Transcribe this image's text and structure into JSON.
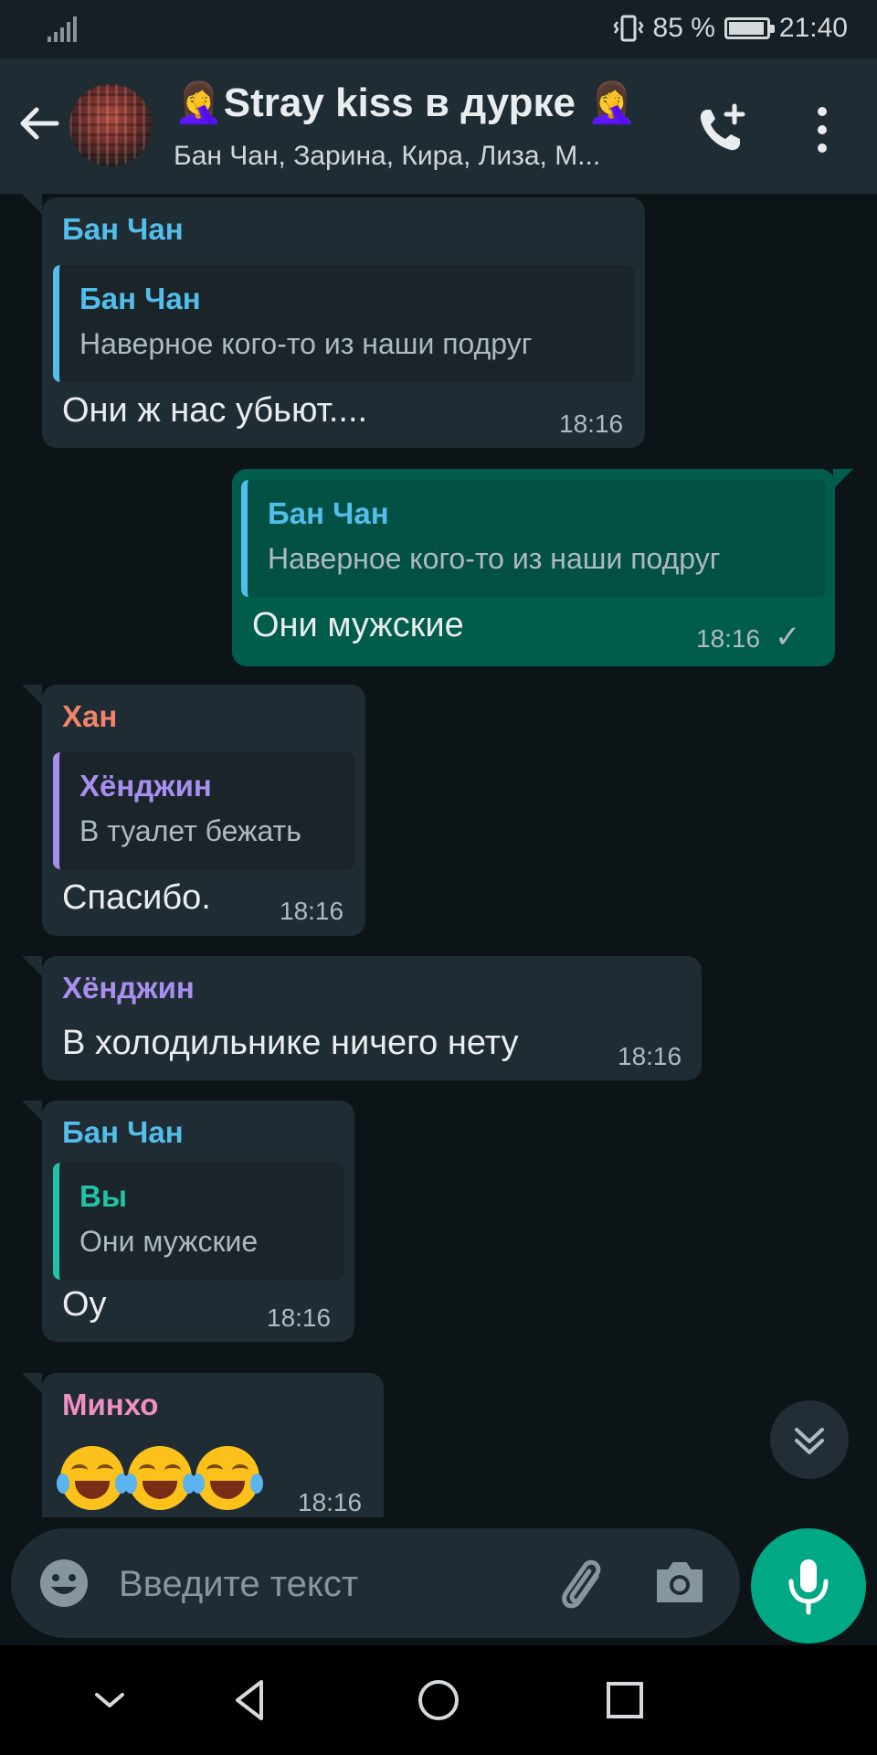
{
  "status_bar": {
    "battery": "85 %",
    "battery_level": 0.85,
    "time": "21:40"
  },
  "header": {
    "title": "🤦‍♀️Stray kiss в дурке 🤦‍♀️",
    "subtitle": "Бан Чан, Зарина, Кира, Лиза, М..."
  },
  "colors": {
    "banchan": "#53bdeb",
    "han": "#f2836b",
    "hyunjin": "#a78ff0",
    "minho": "#f08fc4",
    "you": "#21c3a6",
    "outgoing": "#005c4b",
    "mic": "#00a884"
  },
  "messages": [
    {
      "direction": "in",
      "sender": "Бан Чан",
      "quote_name": "Бан Чан",
      "quote_text": "Наверное кого-то из наши подруг",
      "text": "Они ж нас убьют....",
      "time": "18:16"
    },
    {
      "direction": "out",
      "quote_name": "Бан Чан",
      "quote_text": "Наверное кого-то из наши подруг",
      "text": "Они мужские",
      "time": "18:16",
      "status": "✓"
    },
    {
      "direction": "in",
      "sender": "Хан",
      "quote_name": "Хёнджин",
      "quote_text": "В туалет бежать",
      "text": "Спасибо.",
      "time": "18:16"
    },
    {
      "direction": "in",
      "sender": "Хёнджин",
      "text": "В холодильнике ничего нету",
      "time": "18:16"
    },
    {
      "direction": "in",
      "sender": "Бан Чан",
      "quote_name": "Вы",
      "quote_text": "Они мужские",
      "text": "Оу",
      "time": "18:16"
    },
    {
      "direction": "in",
      "sender": "Минхо",
      "emoji_count": 3,
      "emoji_name": "face-with-tears-of-joy",
      "time": "18:16"
    }
  ],
  "input": {
    "placeholder": "Введите текст"
  },
  "icons": {
    "back": "arrow-left-icon",
    "call_add": "phone-add-icon",
    "menu": "more-vert-icon",
    "scroll_down": "double-chevron-down-icon",
    "emoji": "smiley-icon",
    "attach": "paperclip-icon",
    "camera": "camera-icon",
    "mic": "mic-icon"
  }
}
